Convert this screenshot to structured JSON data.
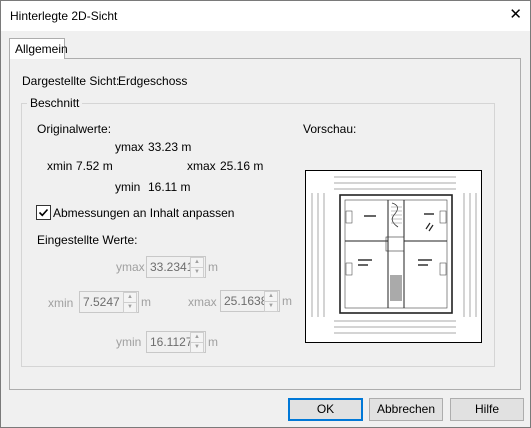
{
  "window": {
    "title": "Hinterlegte 2D-Sicht",
    "close_glyph": "✕"
  },
  "tabs": [
    {
      "label": "Allgemein",
      "active": true
    }
  ],
  "view": {
    "label": "Dargestellte Sicht:",
    "value": "Erdgeschoss"
  },
  "clip_group": {
    "label": "Beschnitt"
  },
  "original": {
    "label": "Originalwerte:",
    "ymax_label": "ymax",
    "ymax": "33.23 m",
    "xmin_label": "xmin",
    "xmin": "7.52 m",
    "xmax_label": "xmax",
    "xmax": "25.16 m",
    "ymin_label": "ymin",
    "ymin": "16.11 m"
  },
  "fit_checkbox": {
    "label": "Abmessungen an Inhalt anpassen",
    "checked": true
  },
  "set_values": {
    "label": "Eingestellte Werte:",
    "ymax_label": "ymax",
    "ymax": "33.2341",
    "xmin_label": "xmin",
    "xmin": "7.5247",
    "xmax_label": "xmax",
    "xmax": "25.1638",
    "ymin_label": "ymin",
    "ymin": "16.1127",
    "unit": "m"
  },
  "preview": {
    "label": "Vorschau:"
  },
  "buttons": {
    "ok": "OK",
    "cancel": "Abbrechen",
    "help": "Hilfe"
  },
  "colors": {
    "default_button_border": "#0078d7",
    "disabled_text": "#a0a0a0"
  }
}
